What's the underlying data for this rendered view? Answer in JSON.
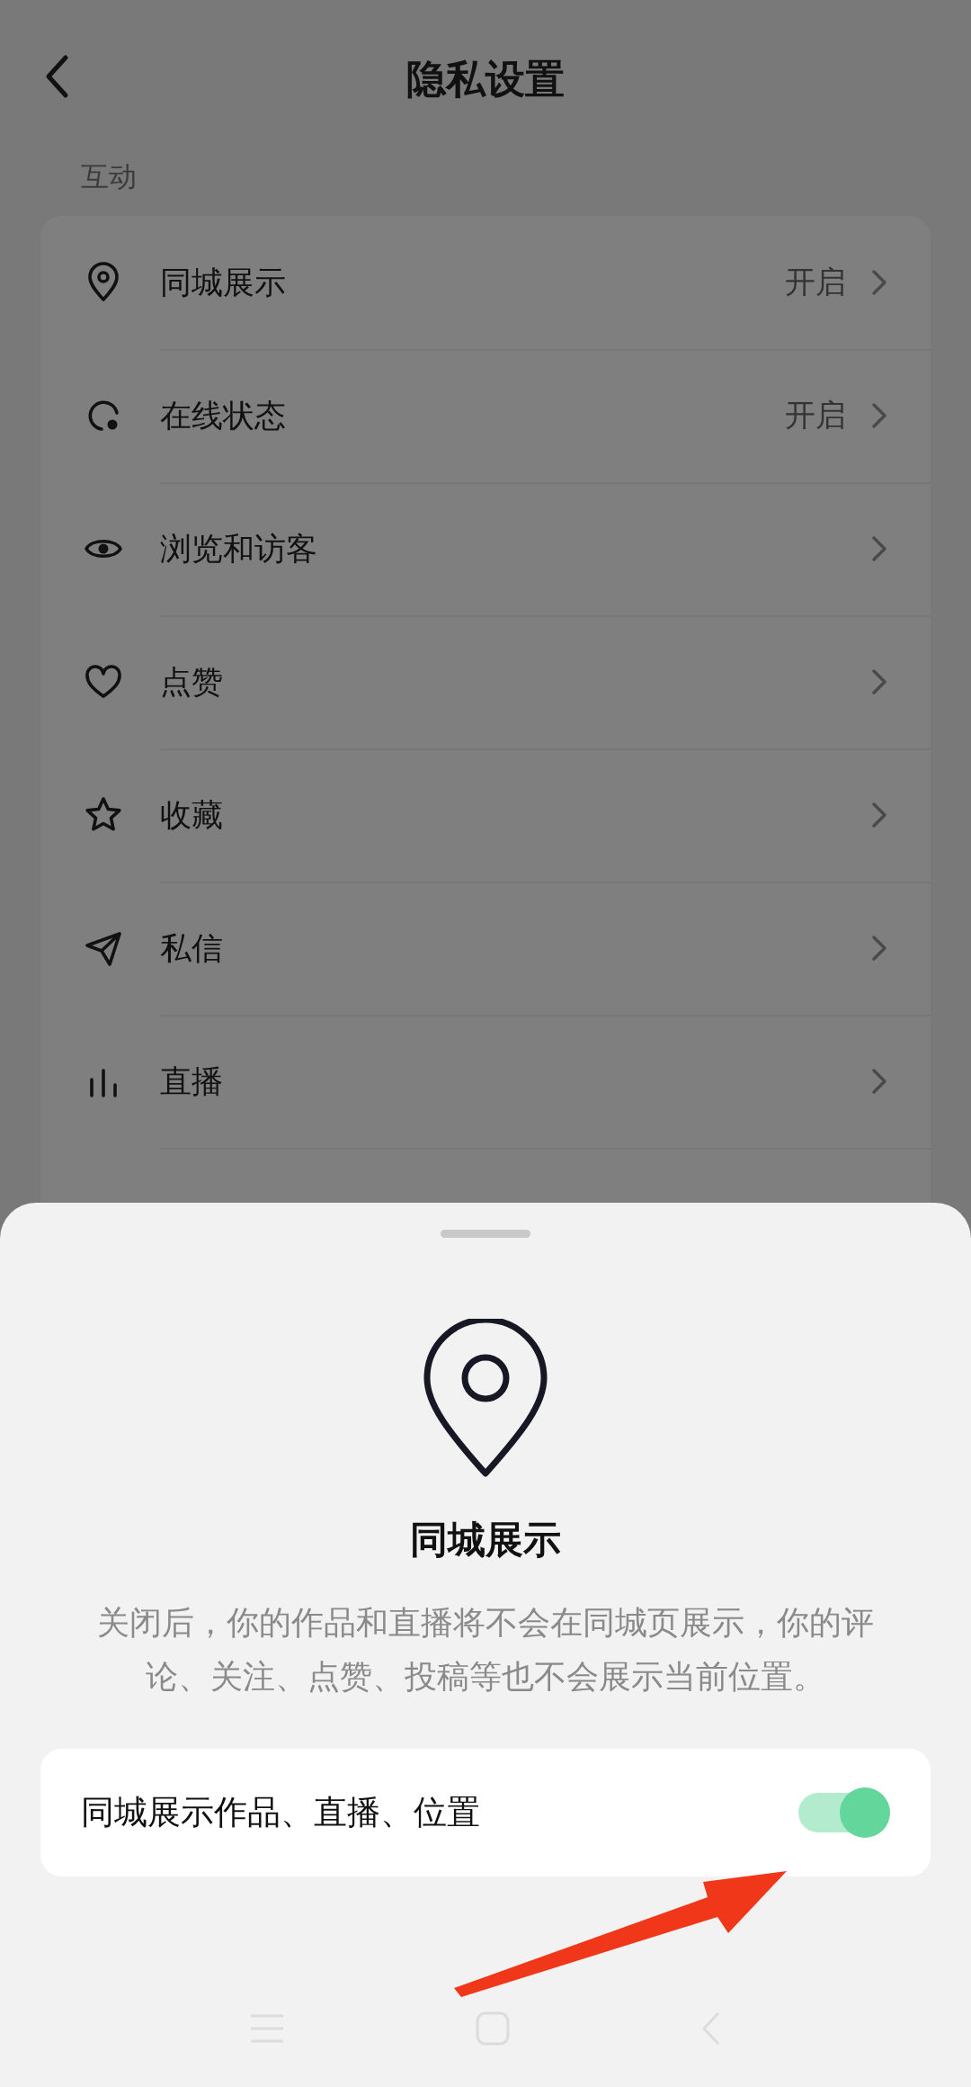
{
  "header": {
    "title": "隐私设置"
  },
  "section": {
    "label": "互动"
  },
  "rows": [
    {
      "label": "同城展示",
      "value": "开启"
    },
    {
      "label": "在线状态",
      "value": "开启"
    },
    {
      "label": "浏览和访客"
    },
    {
      "label": "点赞"
    },
    {
      "label": "收藏"
    },
    {
      "label": "私信"
    },
    {
      "label": "直播"
    }
  ],
  "sheet": {
    "title": "同城展示",
    "description": "关闭后，你的作品和直播将不会在同城页展示，你的评论、关注、点赞、投稿等也不会展示当前位置。",
    "toggle": {
      "label": "同城展示作品、直播、位置",
      "on": true
    }
  }
}
